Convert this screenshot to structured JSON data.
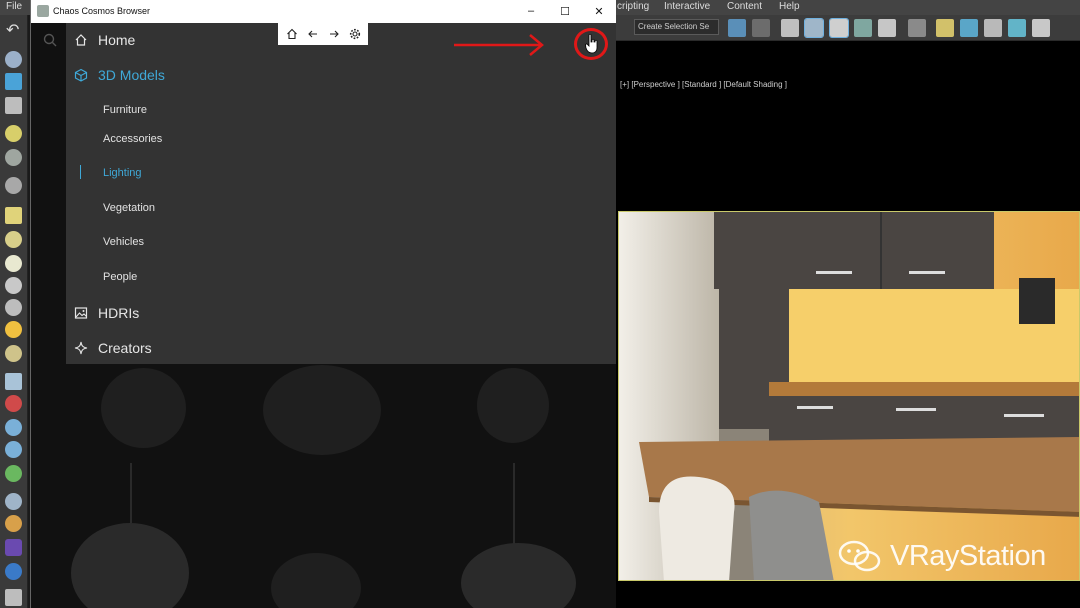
{
  "max": {
    "menu": {
      "file": "File",
      "scripting": "cripting",
      "interactive": "Interactive",
      "content": "Content",
      "help": "Help"
    },
    "toolbar": {
      "selection_set": "Create Selection Se"
    },
    "viewport_label": "[+] [Perspective ] [Standard ] [Default Shading ]",
    "watermark": "VRayStation"
  },
  "window": {
    "title": "Chaos Cosmos Browser",
    "controls": {
      "minimize": "–",
      "maximize": "☐",
      "close": "✕"
    }
  },
  "nav": {
    "home": "Home",
    "models": "3D Models",
    "subitems": [
      "Furniture",
      "Accessories",
      "Lighting",
      "Vegetation",
      "Vehicles",
      "People"
    ],
    "active_subitem": "Lighting",
    "hdris": "HDRIs",
    "creators": "Creators"
  },
  "colors": {
    "accent": "#3fa9d8",
    "annotation": "#e01818"
  },
  "icons": {
    "home": "home-icon",
    "models": "cube-icon",
    "hdris": "image-icon",
    "creators": "sparkle-icon",
    "back": "arrow-left-icon",
    "forward": "arrow-right-icon",
    "settings": "gear-icon",
    "search": "search-icon",
    "cursor": "hand-cursor-icon"
  }
}
